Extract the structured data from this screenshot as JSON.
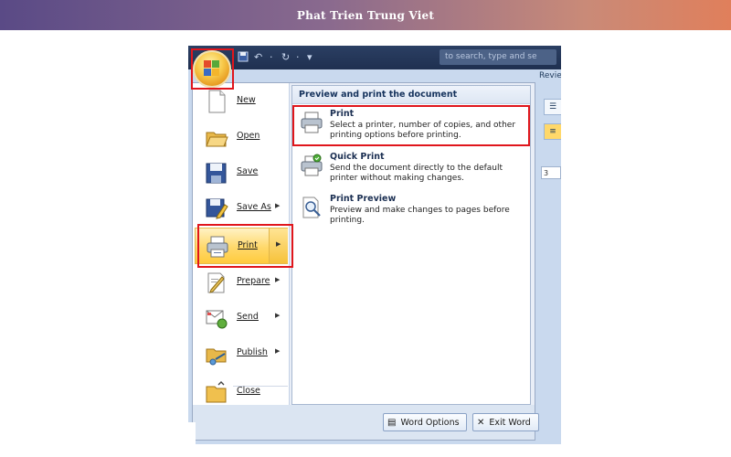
{
  "banner": {
    "title": "Phat Trien Trung Viet"
  },
  "quick_access": {
    "search_placeholder": "to search, type and se"
  },
  "ribbon": {
    "tab_partial": "Revie",
    "ruler_value": "3"
  },
  "office_menu": {
    "left_items": [
      {
        "label": "New",
        "icon": "new-document-icon",
        "has_submenu": false
      },
      {
        "label": "Open",
        "icon": "open-folder-icon",
        "has_submenu": false
      },
      {
        "label": "Save",
        "icon": "save-icon",
        "has_submenu": false
      },
      {
        "label": "Save As",
        "icon": "save-as-icon",
        "has_submenu": true
      },
      {
        "label": "Print",
        "icon": "printer-icon",
        "has_submenu": true,
        "active": true
      },
      {
        "label": "Prepare",
        "icon": "prepare-icon",
        "has_submenu": true
      },
      {
        "label": "Send",
        "icon": "send-icon",
        "has_submenu": true
      },
      {
        "label": "Publish",
        "icon": "publish-icon",
        "has_submenu": true
      },
      {
        "label": "Close",
        "icon": "close-folder-icon",
        "has_submenu": false
      }
    ],
    "panel": {
      "heading": "Preview and print the document",
      "options": [
        {
          "title": "Print",
          "description": "Select a printer, number of copies, and other printing options before printing.",
          "icon": "printer-icon"
        },
        {
          "title": "Quick Print",
          "description": "Send the document directly to the default printer without making changes.",
          "icon": "quick-print-icon"
        },
        {
          "title": "Print Preview",
          "description": "Preview and make changes to pages before printing.",
          "icon": "print-preview-icon"
        }
      ]
    },
    "footer": {
      "options_label": "Word Options",
      "exit_label": "Exit Word"
    }
  },
  "colors": {
    "highlight_border": "#e0161c",
    "active_item": "#ffd86a",
    "panel_heading": "#15325c"
  }
}
